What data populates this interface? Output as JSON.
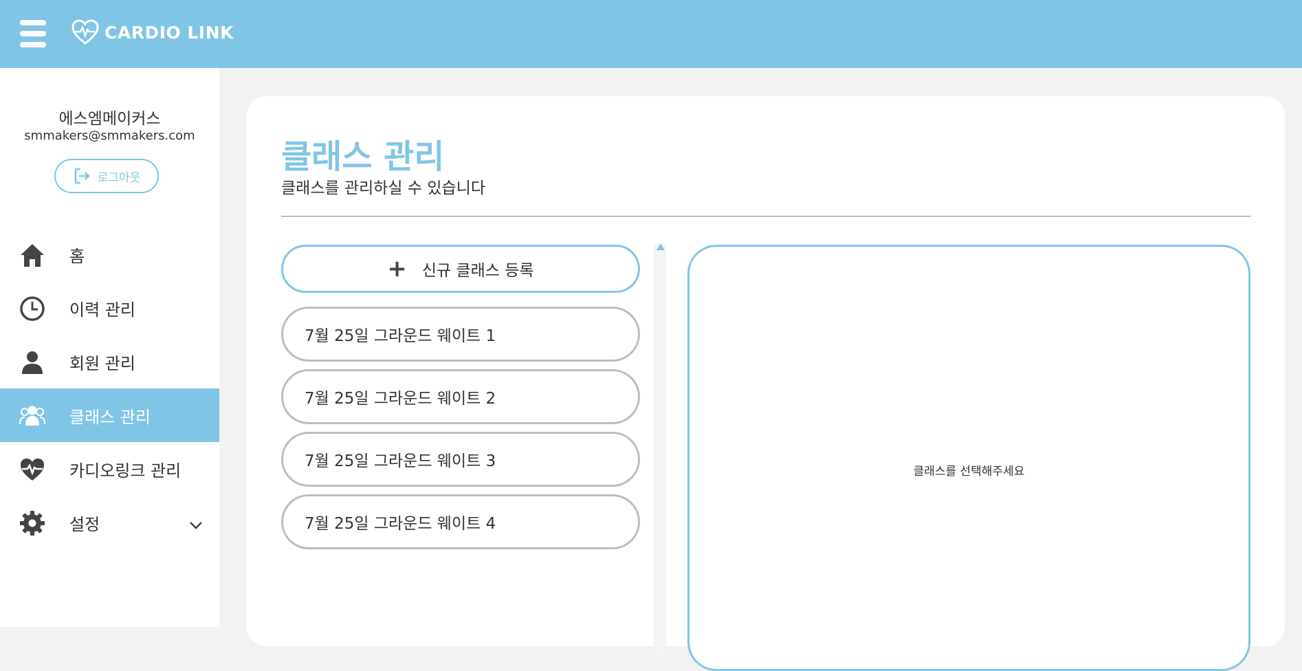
{
  "header": {
    "brand": "CARDIO LINK",
    "brand_color": "#81c5e6"
  },
  "sidebar": {
    "user_name": "에스엠메이커스",
    "user_email": "smmakers@smmakers.com",
    "logout_label": "로그아웃",
    "items": [
      {
        "label": "홈",
        "icon": "home-icon"
      },
      {
        "label": "이력 관리",
        "icon": "clock-icon"
      },
      {
        "label": "회원 관리",
        "icon": "user-icon"
      },
      {
        "label": "클래스 관리",
        "icon": "group-icon",
        "active": true
      },
      {
        "label": "카디오링크 관리",
        "icon": "heart-pulse-icon"
      },
      {
        "label": "설정",
        "icon": "gear-icon"
      }
    ]
  },
  "main": {
    "title": "클래스 관리",
    "subtitle": "클래스를 관리하실 수 있습니다",
    "add_button_label": "신규 클래스 등록",
    "classes": [
      "7월 25일 그라운드 웨이트 1",
      "7월 25일 그라운드 웨이트 2",
      "7월 25일 그라운드 웨이트 3",
      "7월 25일 그라운드 웨이트 4"
    ],
    "empty_detail": "클래스를 선택해주세요"
  }
}
